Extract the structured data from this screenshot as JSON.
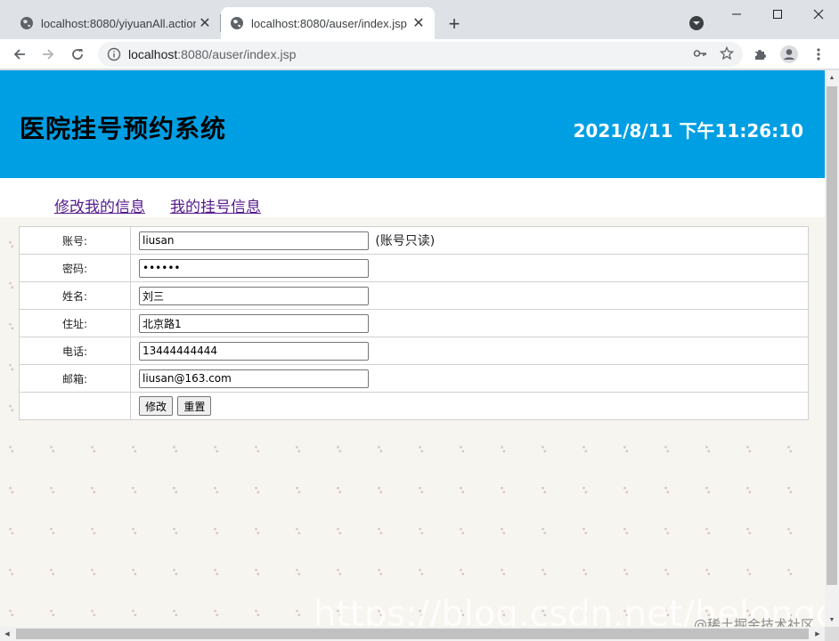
{
  "browser": {
    "tabs": [
      {
        "title": "localhost:8080/yiyuanAll.action",
        "active": false
      },
      {
        "title": "localhost:8080/auser/index.jsp",
        "active": true
      }
    ],
    "address": {
      "host": "localhost",
      "path": ":8080/auser/index.jsp"
    },
    "icons": [
      "globe-icon",
      "close-icon",
      "plus-icon",
      "tab-search-icon",
      "minimize-icon",
      "maximize-icon",
      "window-close-icon",
      "back-icon",
      "forward-icon",
      "reload-icon",
      "info-icon",
      "key-icon",
      "star-icon",
      "extensions-icon",
      "profile-icon",
      "menu-icon"
    ]
  },
  "page": {
    "system_title": "医院挂号预约系统",
    "datetime": "2021/8/11 下午11:26:10",
    "nav": [
      {
        "label": "修改我的信息"
      },
      {
        "label": "我的挂号信息"
      }
    ],
    "form": {
      "rows": [
        {
          "label": "账号:",
          "value": "liusan",
          "type": "text",
          "note": "(账号只读)"
        },
        {
          "label": "密码:",
          "value": "123456",
          "type": "password"
        },
        {
          "label": "姓名:",
          "value": "刘三",
          "type": "text"
        },
        {
          "label": "住址:",
          "value": "北京路1",
          "type": "text"
        },
        {
          "label": "电话:",
          "value": "13444444444",
          "type": "text"
        },
        {
          "label": "邮箱:",
          "value": "liusan@163.com",
          "type": "text"
        }
      ],
      "submit_label": "修改",
      "reset_label": "重置"
    },
    "watermark": "https://blog.csdn.net/helongqiang",
    "watermark_site": "@稀土掘金技术社区"
  },
  "colors": {
    "header_bg": "#009fe3",
    "link": "#551a8b"
  }
}
